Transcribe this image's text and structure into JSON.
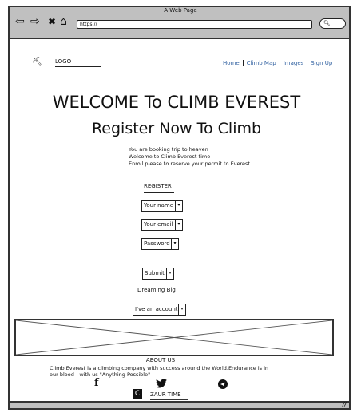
{
  "browser": {
    "title": "A Web Page",
    "url": "https://",
    "nav_icons": [
      "back-arrow-icon",
      "forward-arrow-icon",
      "close-x-icon",
      "home-icon"
    ],
    "search_icon": "search-icon"
  },
  "header": {
    "logo_icon": "climber-icon",
    "logo_label": "LOGO",
    "menu": [
      {
        "label": "Home"
      },
      {
        "label": "Climb Map"
      },
      {
        "label": "Images"
      },
      {
        "label": "Sign Up"
      }
    ],
    "link_color": "#3060a0"
  },
  "hero": {
    "title": "WELCOME To CLIMB EVEREST",
    "subtitle": "Register Now To Climb",
    "lines": [
      "You are booking trip to heaven",
      "Welcome to Climb Everest time",
      "Enroll please to reserve your permit to Everest"
    ]
  },
  "form": {
    "heading": "REGISTER",
    "name": "Your name",
    "email": "Your email",
    "password": "Password",
    "submit": "Submit",
    "dreaming": "Dreaming Big",
    "account": "I've an account"
  },
  "footer": {
    "about_title": "ABOUT US",
    "about_text": "Climb Everest is a climbing company with success around the World.Endurance is in our blood - with us \"Anything Possible\"",
    "social": [
      "facebook-icon",
      "twitter-icon",
      "telegram-icon"
    ],
    "copyright_icon": "copyright-icon",
    "brand": "ZAUR TIME"
  }
}
